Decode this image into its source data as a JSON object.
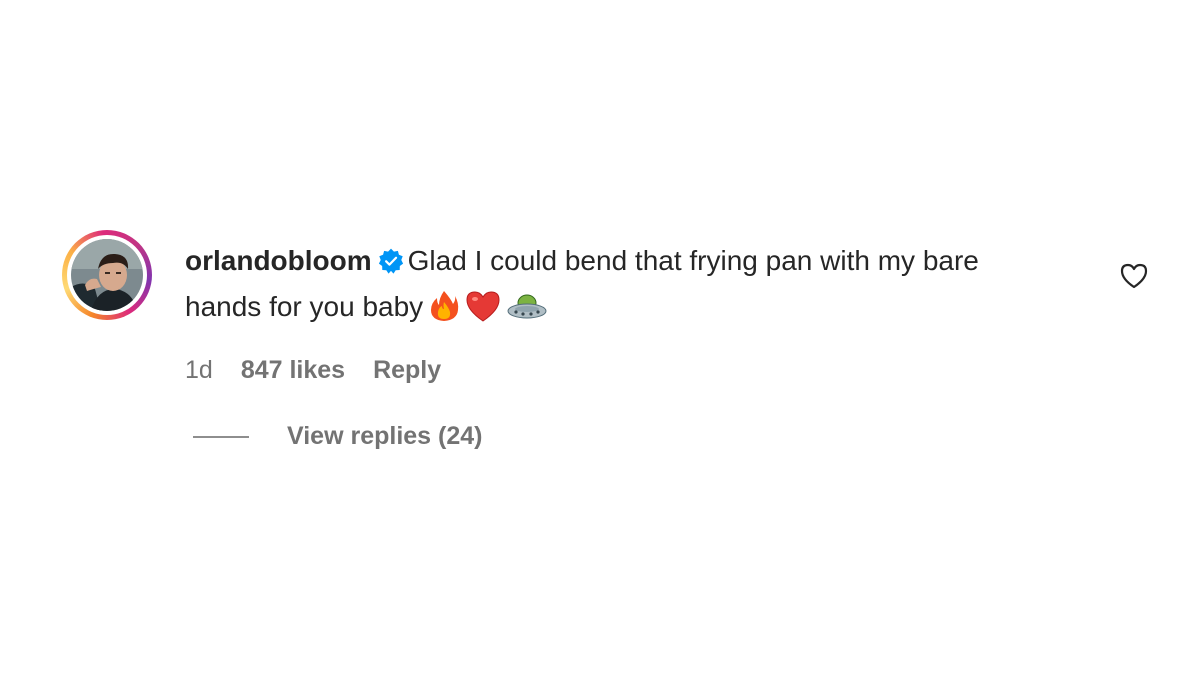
{
  "comment": {
    "username": "orlandobloom",
    "verified": true,
    "text": "Glad I could bend that frying pan with my bare hands for you baby",
    "emojis": [
      "fire-emoji",
      "red-heart-emoji",
      "flying-saucer-emoji"
    ],
    "time": "1d",
    "likes": "847 likes",
    "reply_label": "Reply",
    "view_replies_label": "View replies (24)",
    "like_icon": "heart-outline-icon"
  },
  "colors": {
    "text": "#262626",
    "secondary_text": "#737373",
    "verified_badge": "#0095f6",
    "background": "#ffffff"
  }
}
